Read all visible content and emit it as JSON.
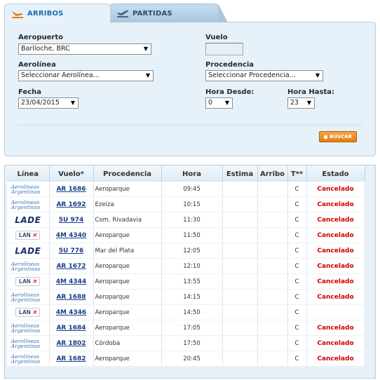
{
  "tabs": {
    "arribos": "ARRIBOS",
    "partidas": "PARTIDAS"
  },
  "form": {
    "aeropuerto_label": "Aeropuerto",
    "aeropuerto_value": "Bariloche, BRC",
    "vuelo_label": "Vuelo",
    "vuelo_value": "",
    "aerolinea_label": "Aerolínea",
    "aerolinea_value": "Seleccionar Aerolínea...",
    "procedencia_label": "Procedencia",
    "procedencia_value": "Seleccionar Procedencia...",
    "fecha_label": "Fecha",
    "fecha_value": "23/04/2015",
    "hora_desde_label": "Hora Desde:",
    "hora_desde_value": "0",
    "hora_hasta_label": "Hora Hasta:",
    "hora_hasta_value": "23",
    "buscar_label": "BUSCAR"
  },
  "table": {
    "headers": [
      "Línea",
      "Vuelo*",
      "Procedencia",
      "Hora",
      "Estima",
      "Arribo",
      "T**",
      "Estado"
    ],
    "rows": [
      {
        "airline": "Aerolíneas Argentinas",
        "vuelo": "AR 1686",
        "procedencia": "Aeroparque",
        "hora": "09:45",
        "estima": "",
        "arribo": "",
        "t": "C",
        "estado": "Cancelado"
      },
      {
        "airline": "Aerolíneas Argentinas",
        "vuelo": "AR 1692",
        "procedencia": "Ezeiza",
        "hora": "10:15",
        "estima": "",
        "arribo": "",
        "t": "C",
        "estado": "Cancelado"
      },
      {
        "airline": "LADE",
        "vuelo": "5U 974",
        "procedencia": "Com. Rivadavia",
        "hora": "11:30",
        "estima": "",
        "arribo": "",
        "t": "C",
        "estado": "Cancelado"
      },
      {
        "airline": "LAN",
        "vuelo": "4M 4340",
        "procedencia": "Aeroparque",
        "hora": "11:50",
        "estima": "",
        "arribo": "",
        "t": "C",
        "estado": "Cancelado"
      },
      {
        "airline": "LADE",
        "vuelo": "5U 776",
        "procedencia": "Mar del Plata",
        "hora": "12:05",
        "estima": "",
        "arribo": "",
        "t": "C",
        "estado": "Cancelado"
      },
      {
        "airline": "Aerolíneas Argentinas",
        "vuelo": "AR 1672",
        "procedencia": "Aeroparque",
        "hora": "12:10",
        "estima": "",
        "arribo": "",
        "t": "C",
        "estado": "Cancelado"
      },
      {
        "airline": "LAN",
        "vuelo": "4M 4344",
        "procedencia": "Aeroparque",
        "hora": "13:55",
        "estima": "",
        "arribo": "",
        "t": "C",
        "estado": "Cancelado"
      },
      {
        "airline": "Aerolíneas Argentinas",
        "vuelo": "AR 1688",
        "procedencia": "Aeroparque",
        "hora": "14:15",
        "estima": "",
        "arribo": "",
        "t": "C",
        "estado": "Cancelado"
      },
      {
        "airline": "LAN",
        "vuelo": "4M 4346",
        "procedencia": "Aeroparque",
        "hora": "14:50",
        "estima": "",
        "arribo": "",
        "t": "C",
        "estado": ""
      },
      {
        "airline": "Aerolíneas Argentinas",
        "vuelo": "AR 1684",
        "procedencia": "Aeroparque",
        "hora": "17:05",
        "estima": "",
        "arribo": "",
        "t": "C",
        "estado": "Cancelado"
      },
      {
        "airline": "Aerolíneas Argentinas",
        "vuelo": "AR 1802",
        "procedencia": "Córdoba",
        "hora": "17:50",
        "estima": "",
        "arribo": "",
        "t": "C",
        "estado": "Cancelado"
      },
      {
        "airline": "Aerolíneas Argentinas",
        "vuelo": "AR 1682",
        "procedencia": "Aeroparque",
        "hora": "20:45",
        "estima": "",
        "arribo": "",
        "t": "C",
        "estado": "Cancelado"
      }
    ]
  },
  "colors": {
    "accent_orange": "#e27d0f",
    "cancel_red": "#d10000",
    "link_blue": "#1a3c8c",
    "panel_bg": "#e6f1f9"
  },
  "icons": {
    "arribos": "plane-landing-icon",
    "partidas": "plane-takeoff-icon"
  }
}
